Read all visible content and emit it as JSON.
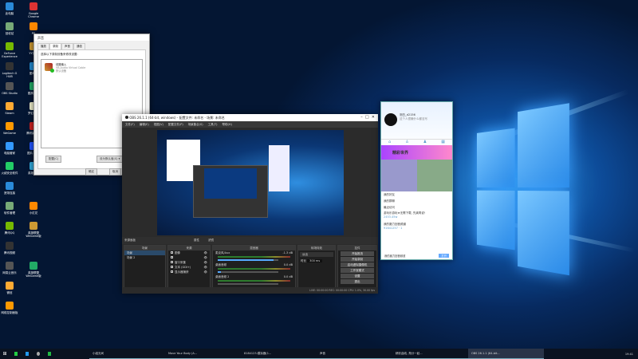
{
  "desktop": {
    "icons": [
      "此电脑",
      "Google Chrome",
      "回收站",
      "PS",
      "GeForce Experience",
      "YY语音",
      "Logitech G HUB",
      "爱奇艺",
      "OBS Studio",
      "酷狗音乐",
      "Steam",
      "梦幻西游",
      "WeGame",
      "腾讯影视库",
      "电脑管家",
      "图片1.jpg",
      "火绒安全软件",
      "英雄联盟",
      "宽带连接",
      "",
      "软件管理",
      "小红花",
      "腾讯QQ",
      "英雄联盟WeGame版",
      "腾讯视频",
      "",
      "网易云音乐",
      "英雄联盟WeGame版",
      "微信",
      "",
      "网络控制面板",
      ""
    ]
  },
  "sound_dialog": {
    "title": "声音",
    "tabs": [
      "播放",
      "录制",
      "声音",
      "通信"
    ],
    "active_tab": 1,
    "instruction": "选择以下录制设备来修改设置:",
    "device_name": "线路输入",
    "device_sub": "VB-Audio Virtual Cable",
    "device_status": "默认设备",
    "configure": "配置(C)",
    "set_default": "设为默认值(S) ▾",
    "ok": "确定",
    "cancel": "取消"
  },
  "obs": {
    "title": "OBS 26.1.1 (64-bit, windows) - 配置文件: 未命名 - 场景: 未命名",
    "menu": [
      "文件(F)",
      "编辑(E)",
      "视图(V)",
      "配置文件(P)",
      "场景集合(S)",
      "工具(T)",
      "帮助(H)"
    ],
    "dock_header": "来源面板",
    "props": "属性",
    "filters": "滤镜",
    "scenes": {
      "title": "场景",
      "items": [
        "场景",
        "场景 2"
      ]
    },
    "sources": {
      "title": "来源",
      "items": [
        "图像",
        "",
        "窗口采集",
        "文本 (GDI+)",
        "显示器捕获"
      ]
    },
    "mixer": {
      "title": "混音器",
      "channels": [
        {
          "name": "麦克风/Aux",
          "db": "-1.3 dB",
          "level": 0.92
        },
        {
          "name": "桌面音频",
          "db": "0.0 dB",
          "level": 0.05
        },
        {
          "name": "桌面音频 2",
          "db": "0.0 dB",
          "level": 0
        }
      ]
    },
    "transitions": {
      "title": "转场特效",
      "selected": "淡出",
      "duration_label": "时长",
      "duration": "300 ms"
    },
    "controls": {
      "title": "控件",
      "buttons": [
        "开始推流",
        "开始录制",
        "启动虚拟摄像机",
        "工作室模式",
        "设置",
        "退出"
      ]
    },
    "status": "LIVE: 00:00:00   REC: 00:00:00   CPU: 1.0%, 30.00 fps"
  },
  "qq": {
    "nickname": "测白_d2156",
    "signature": "这个人很懒什么都没写",
    "banner": "精彩世界",
    "menu": [
      "我的好友",
      "我的群聊",
      "最近访问"
    ],
    "chats": [
      {
        "name": "游玩乐游玩★无需下载, 先爽再说!",
        "sub": "2453.45w"
      },
      {
        "name": "我的魔力回音频道",
        "sub": "91641257  ·  1"
      }
    ],
    "search": "我的魔力回音频道",
    "btn": "打开"
  },
  "taskbar": {
    "items": [
      "小组无间",
      "Move Your Body (A...",
      "8184123-模拟器(1...",
      "声音",
      "精彩曲线, 角分一起...",
      "OBS 26.1.1 (64-bit..."
    ],
    "active": 5,
    "time": "19:41"
  }
}
